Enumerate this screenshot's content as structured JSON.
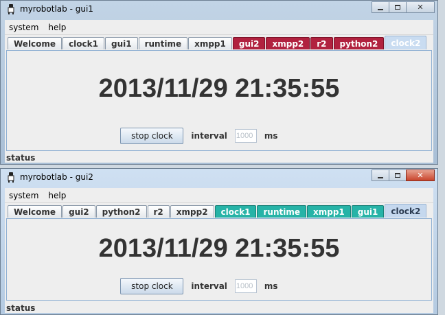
{
  "windows": [
    {
      "title": "myrobotlab - gui1",
      "menu": [
        "system",
        "help"
      ],
      "tabs": [
        {
          "label": "Welcome",
          "style": "plain"
        },
        {
          "label": "clock1",
          "style": "plain"
        },
        {
          "label": "gui1",
          "style": "plain"
        },
        {
          "label": "runtime",
          "style": "plain"
        },
        {
          "label": "xmpp1",
          "style": "plain"
        },
        {
          "label": "gui2",
          "style": "red"
        },
        {
          "label": "xmpp2",
          "style": "red"
        },
        {
          "label": "r2",
          "style": "red"
        },
        {
          "label": "python2",
          "style": "red"
        },
        {
          "label": "clock2",
          "style": "selected"
        }
      ],
      "clock_time": "2013/11/29 21:35:55",
      "stop_button": "stop clock",
      "interval_label": "interval",
      "interval_value": "1000",
      "unit_label": "ms",
      "status": "status"
    },
    {
      "title": "myrobotlab - gui2",
      "menu": [
        "system",
        "help"
      ],
      "tabs": [
        {
          "label": "Welcome",
          "style": "plain"
        },
        {
          "label": "gui2",
          "style": "plain"
        },
        {
          "label": "python2",
          "style": "plain"
        },
        {
          "label": "r2",
          "style": "plain"
        },
        {
          "label": "xmpp2",
          "style": "plain"
        },
        {
          "label": "clock1",
          "style": "teal"
        },
        {
          "label": "runtime",
          "style": "teal"
        },
        {
          "label": "xmpp1",
          "style": "teal"
        },
        {
          "label": "gui1",
          "style": "teal"
        },
        {
          "label": "clock2",
          "style": "selected"
        }
      ],
      "clock_time": "2013/11/29 21:35:55",
      "stop_button": "stop clock",
      "interval_label": "interval",
      "interval_value": "1000",
      "unit_label": "ms",
      "status": "status"
    }
  ],
  "colors": {
    "remote_tab_gui1": "#b1223f",
    "remote_tab_gui2": "#26b3a7",
    "selected_tab": "#c9dcf1"
  },
  "icons": {
    "app": "robot-icon",
    "minimize": "minimize-icon",
    "maximize": "maximize-icon",
    "close": "close-icon"
  }
}
